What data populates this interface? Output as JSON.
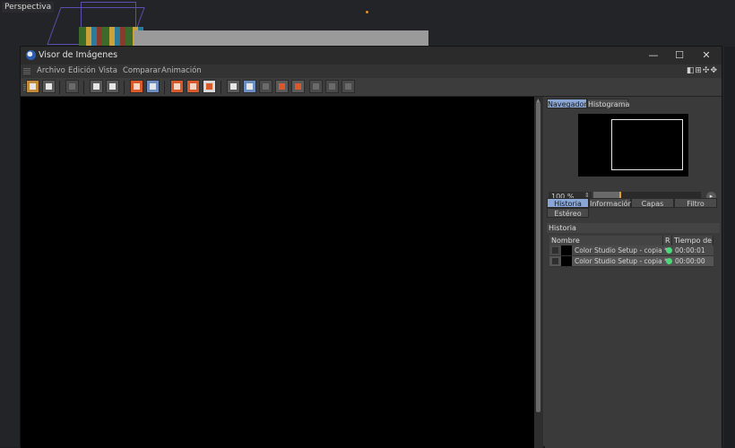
{
  "viewport": {
    "label": "Perspectiva"
  },
  "window": {
    "title": "Visor de Imágenes",
    "controls": {
      "minimize": "—",
      "maximize": "☐",
      "close": "✕"
    },
    "menu": [
      "Archivo",
      "Edición",
      "Vista",
      "Comparar",
      "Animación"
    ],
    "menu_right_icons": "◧⊞✣✥"
  },
  "side": {
    "top_tabs": [
      "Navegador",
      "Histograma"
    ],
    "zoom": "100 %",
    "zoom_spin": "⇕",
    "zoom_go": "▸",
    "zoom_level": 0.25,
    "tabs_row1": [
      "Historia",
      "Información",
      "Capas",
      "Filtro"
    ],
    "tabs_row2": [
      "Estéreo"
    ],
    "section_title": "Historia",
    "columns": [
      "Nombre",
      "R",
      "Tiempo de R"
    ],
    "rows": [
      {
        "name": "Color Studio Setup - copia *",
        "time": "00:00:01"
      },
      {
        "name": "Color Studio Setup - copia *",
        "time": "00:00:00"
      }
    ]
  },
  "colors": {
    "accent": "#8aa6d4",
    "render_ok": "#4cd87a",
    "tool_orange": "#d85a2a"
  }
}
